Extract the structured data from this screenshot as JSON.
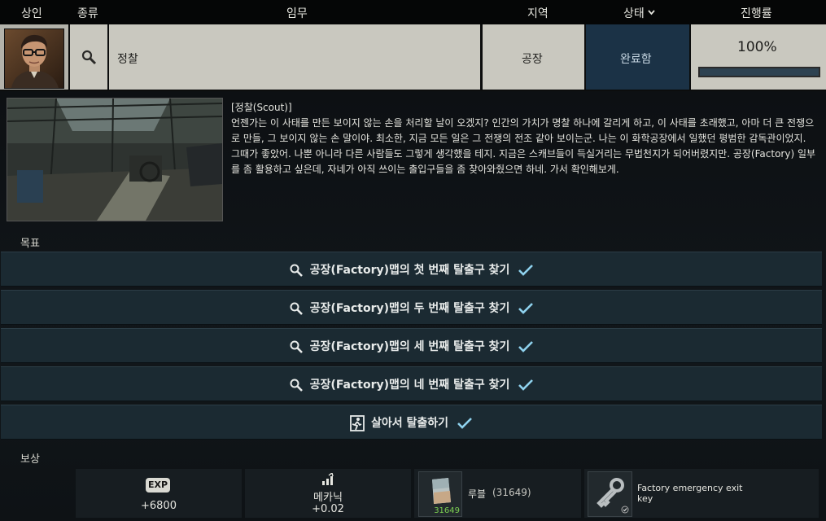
{
  "header": {
    "trader": "상인",
    "type": "종류",
    "task": "임무",
    "location": "지역",
    "status": "상태",
    "progress": "진행률"
  },
  "quest": {
    "name": "정찰",
    "location": "공장",
    "status": "완료함",
    "progress_label": "100%",
    "progress_value": 1.0
  },
  "description": {
    "title": "[정찰(Scout)]",
    "body": "언젠가는 이 사태를 만든 보이지 않는 손을 처리할 날이 오겠지? 인간의 가치가 명찰 하나에 갈리게 하고, 이 사태를 초래했고, 아마 더 큰 전쟁으로 만들, 그 보이지 않는 손 말이야. 최소한, 지금 모든 일은 그 전쟁의 전조 같아 보이는군. 나는 이 화학공장에서 일했던 평범한 감독관이었지. 그때가 좋았어. 나뿐 아니라 다른 사람들도 그렇게 생각했을 테지. 지금은 스캐브들이 득실거리는 무법천지가 되어버렸지만. 공장(Factory) 일부를 좀 활용하고 싶은데, 자네가 아직 쓰이는 출입구들을 좀 찾아와줬으면 하네. 가서 확인해보게."
  },
  "objectives_label": "목표",
  "objectives": [
    {
      "text": "공장(Factory)맵의 첫 번째 탈출구 찾기",
      "icon": "search-icon",
      "done": true
    },
    {
      "text": "공장(Factory)맵의 두 번째 탈출구 찾기",
      "icon": "search-icon",
      "done": true
    },
    {
      "text": "공장(Factory)맵의 세 번째 탈출구 찾기",
      "icon": "search-icon",
      "done": true
    },
    {
      "text": "공장(Factory)맵의 네 번째 탈출구 찾기",
      "icon": "search-icon",
      "done": true
    },
    {
      "text": "살아서 탈출하기",
      "icon": "exit-run-icon",
      "done": true
    }
  ],
  "rewards_label": "보상",
  "rewards": {
    "exp_badge": "EXP",
    "exp": "+6800",
    "skill_name": "메카닉",
    "skill_value": "+0.02",
    "money_label": "루블",
    "money_amount": "(31649)",
    "money_stack": "31649",
    "item_name": "Factory emergency exit key"
  },
  "colors": {
    "status_bg": "#1b3246",
    "cell_bg": "#c9c8bf",
    "objective_bg": "#1b2a32",
    "check": "#8fd2ee",
    "money_count": "#7ccf52"
  }
}
